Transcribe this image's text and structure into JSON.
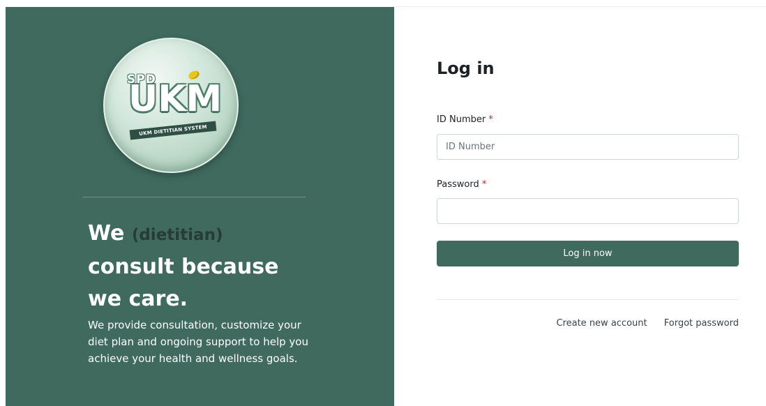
{
  "brand": {
    "logo_top": "SPD",
    "logo_main": "UKM",
    "logo_banner": "UKM DIETITIAN SYSTEM"
  },
  "hero": {
    "headline_we": "We",
    "headline_muted": "(dietitian)",
    "headline_rest": "consult because we care.",
    "description": "We provide consultation, customize your diet plan and ongoing support to help you achieve your health and wellness goals."
  },
  "login": {
    "title": "Log in",
    "id_label": "ID Number",
    "id_placeholder": "ID Number",
    "id_value": "",
    "password_label": "Password",
    "password_value": "",
    "required_mark": "*",
    "submit_label": "Log in now",
    "create_account_label": "Create new account",
    "forgot_password_label": "Forgot password"
  },
  "colors": {
    "brand_green": "#3f6a5d",
    "required_red": "#c81e1e"
  }
}
